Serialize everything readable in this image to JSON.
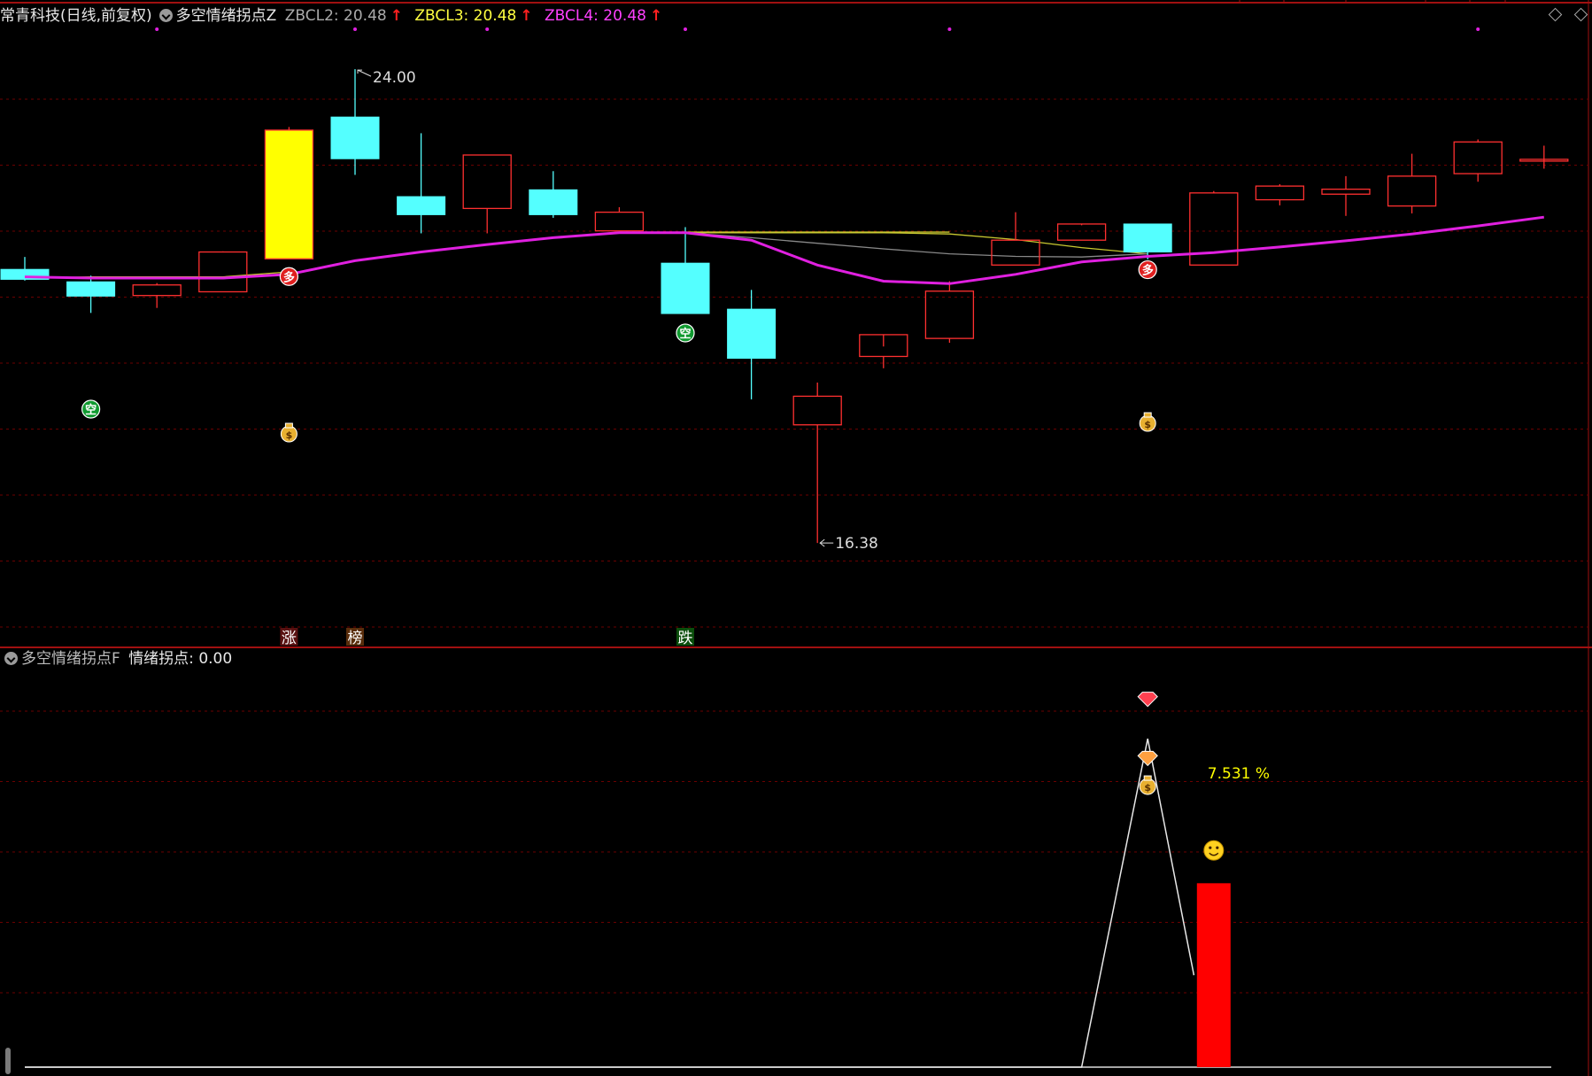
{
  "header_top": {
    "stock": "常青科技(日线,前复权)",
    "indicator": "多空情绪拐点Z",
    "lines": [
      {
        "label": "ZBCL2: 20.48",
        "color": "#aaaaaa"
      },
      {
        "label": "ZBCL3: 20.48",
        "color": "#ffff40"
      },
      {
        "label": "ZBCL4: 20.48",
        "color": "#ff40ff"
      }
    ],
    "arrow": "↑"
  },
  "header_bottom": {
    "indicator": "多空情绪拐点F",
    "value_label": "情绪拐点: 0.00"
  },
  "colors": {
    "up": "#ff3030",
    "down": "#54ffff",
    "limit_up": "#ffff00",
    "ma_main": "#e020e0",
    "ma_yellow": "#c8c830",
    "ma_gray": "#888888",
    "grid": "#6b0000",
    "panel_border": "#a01010",
    "bar": "#ff0000",
    "pct_text": "#ffff00"
  },
  "chart_data": [
    {
      "type": "candlestick",
      "ylim": [
        15.0,
        24.6
      ],
      "candles": [
        {
          "open": 20.78,
          "high": 20.98,
          "low": 20.6,
          "close": 20.62
        },
        {
          "open": 20.58,
          "high": 20.68,
          "low": 20.08,
          "close": 20.35
        },
        {
          "open": 20.36,
          "high": 20.56,
          "low": 20.16,
          "close": 20.53
        },
        {
          "open": 20.42,
          "high": 21.07,
          "low": 20.42,
          "close": 21.06
        },
        {
          "open": 20.95,
          "high": 23.07,
          "low": 20.95,
          "close": 23.02
        },
        {
          "open": 23.23,
          "high": 24.0,
          "low": 22.3,
          "close": 22.56
        },
        {
          "open": 21.95,
          "high": 22.97,
          "low": 21.36,
          "close": 21.66
        },
        {
          "open": 21.76,
          "high": 22.62,
          "low": 21.36,
          "close": 22.62
        },
        {
          "open": 22.06,
          "high": 22.36,
          "low": 21.61,
          "close": 21.66
        },
        {
          "open": 21.4,
          "high": 21.78,
          "low": 21.4,
          "close": 21.7
        },
        {
          "open": 20.88,
          "high": 21.46,
          "low": 20.07,
          "close": 20.07
        },
        {
          "open": 20.14,
          "high": 20.45,
          "low": 18.69,
          "close": 19.35
        },
        {
          "open": 18.28,
          "high": 18.96,
          "low": 16.38,
          "close": 18.74
        },
        {
          "open": 19.38,
          "high": 19.54,
          "low": 19.19,
          "close": 19.73
        },
        {
          "open": 19.67,
          "high": 20.59,
          "low": 19.6,
          "close": 20.43
        },
        {
          "open": 20.85,
          "high": 21.7,
          "low": 20.85,
          "close": 21.25
        },
        {
          "open": 21.25,
          "high": 21.49,
          "low": 21.25,
          "close": 21.51
        },
        {
          "open": 21.51,
          "high": 21.51,
          "low": 20.94,
          "close": 21.06
        },
        {
          "open": 20.85,
          "high": 22.04,
          "low": 20.85,
          "close": 22.01
        },
        {
          "open": 21.9,
          "high": 22.15,
          "low": 21.81,
          "close": 22.12
        },
        {
          "open": 21.99,
          "high": 22.28,
          "low": 21.64,
          "close": 22.07
        },
        {
          "open": 21.8,
          "high": 22.64,
          "low": 21.68,
          "close": 22.28
        },
        {
          "open": 22.32,
          "high": 22.87,
          "low": 22.19,
          "close": 22.83
        },
        {
          "open": 22.55,
          "high": 22.77,
          "low": 22.4,
          "close": 22.55
        }
      ],
      "limit_up_index": 4,
      "ma_main": [
        20.66,
        20.64,
        20.64,
        20.64,
        20.7,
        20.92,
        21.06,
        21.18,
        21.29,
        21.37,
        21.37,
        21.25,
        20.85,
        20.59,
        20.55,
        20.7,
        20.9,
        20.99,
        21.05,
        21.14,
        21.24,
        21.35,
        21.48,
        21.62
      ],
      "ma_yellow": [
        20.64,
        20.66,
        20.66,
        20.66,
        20.74,
        null,
        null,
        null,
        null,
        null,
        21.37,
        21.37,
        21.37,
        21.37,
        21.35,
        21.26,
        21.13,
        21.03
      ],
      "ma_gray": [
        21.37,
        21.29,
        21.2,
        21.11,
        21.03,
        20.99,
        20.98,
        21.03
      ],
      "ma_gray_start": 10,
      "ma_yellow_start": 0,
      "annotations": [
        {
          "text": "24.00",
          "index": 5,
          "value": 24.0,
          "kind": "high"
        },
        {
          "text": "16.38",
          "index": 12,
          "value": 16.38,
          "kind": "low"
        }
      ],
      "signals_bull": [
        {
          "index": 4,
          "text": "多"
        },
        {
          "index": 17,
          "text": "多"
        }
      ],
      "signals_bear": [
        {
          "index": 1,
          "text": "空"
        },
        {
          "index": 10,
          "text": "空"
        }
      ],
      "money_bags": [
        4,
        17
      ],
      "bottom_tags": [
        {
          "index": 4,
          "text": "涨",
          "color": "#ff3030"
        },
        {
          "index": 5,
          "text": "榜",
          "color": "#ff8020"
        },
        {
          "index": 10,
          "text": "跌",
          "color": "#20e020"
        }
      ],
      "top_dots": [
        2,
        5,
        7,
        10,
        14,
        22
      ]
    },
    {
      "type": "line+bar",
      "line_points": [
        {
          "index": 16,
          "value": 0
        },
        {
          "index": 17,
          "value": 100
        },
        {
          "index": 17.7,
          "value": 28
        }
      ],
      "bar": {
        "index": 18,
        "value": 56
      },
      "pct_label": "7.531 %",
      "icons": [
        {
          "name": "gem-red-icon",
          "index": 17,
          "value": 112
        },
        {
          "name": "gem-orange-icon",
          "index": 17,
          "value": 94
        },
        {
          "name": "money-bag-icon",
          "index": 17,
          "value": 86
        },
        {
          "name": "smiley-icon",
          "index": 18,
          "value": 66
        }
      ],
      "ylim": [
        0,
        120
      ]
    }
  ]
}
